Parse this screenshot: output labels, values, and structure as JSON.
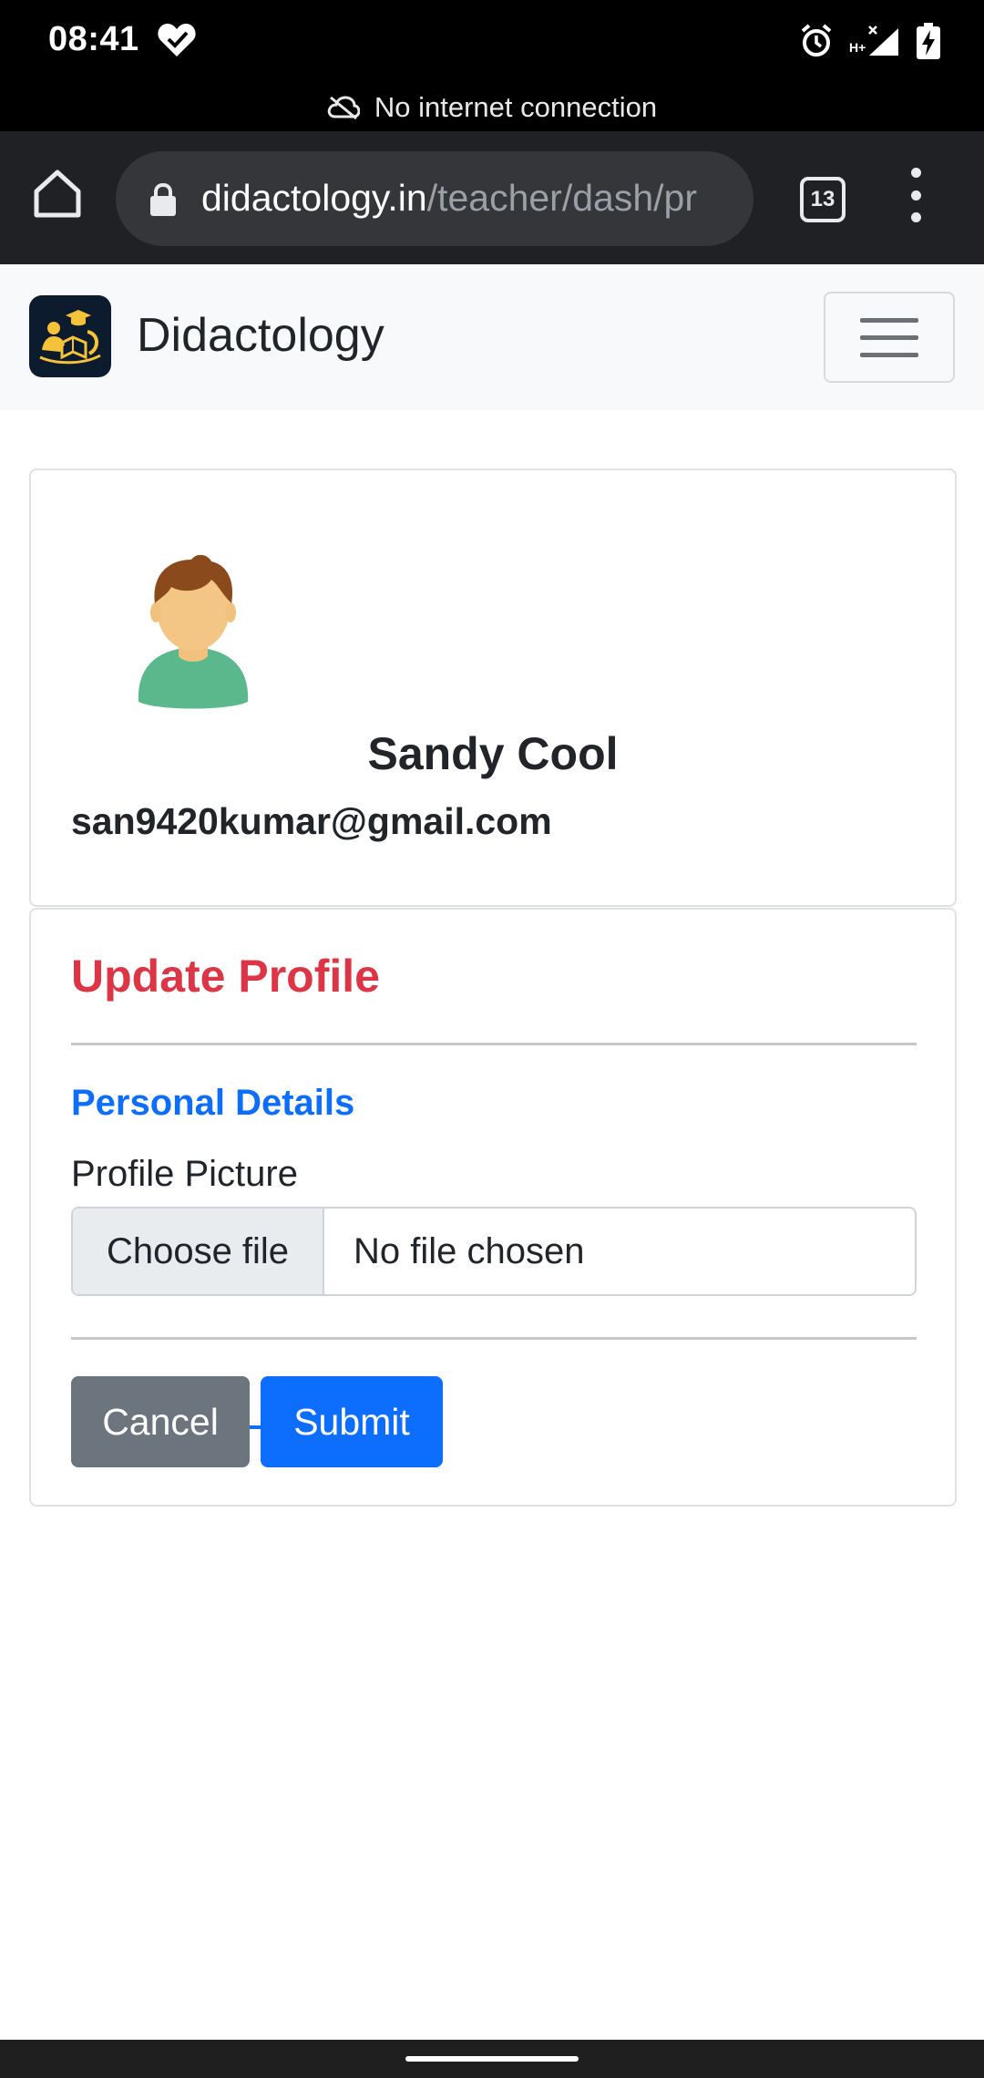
{
  "status_bar": {
    "time": "08:41",
    "offline_message": "No internet connection"
  },
  "browser": {
    "url_domain": "didactology.in",
    "url_path": "/teacher/dash/pr",
    "tab_count": "13"
  },
  "site": {
    "brand": "Didactology"
  },
  "profile": {
    "name": "Sandy Cool",
    "email": "san9420kumar@gmail.com"
  },
  "update_form": {
    "title": "Update Profile",
    "section_label": "Personal Details",
    "picture_label": "Profile Picture",
    "choose_file_label": "Choose file",
    "file_status": "No file chosen",
    "cancel_label": "Cancel",
    "submit_label": "Submit"
  },
  "colors": {
    "title_red": "#dc3545",
    "section_blue": "#0d6efd",
    "cancel_gray": "#6c757d",
    "submit_blue": "#0d6efd"
  }
}
